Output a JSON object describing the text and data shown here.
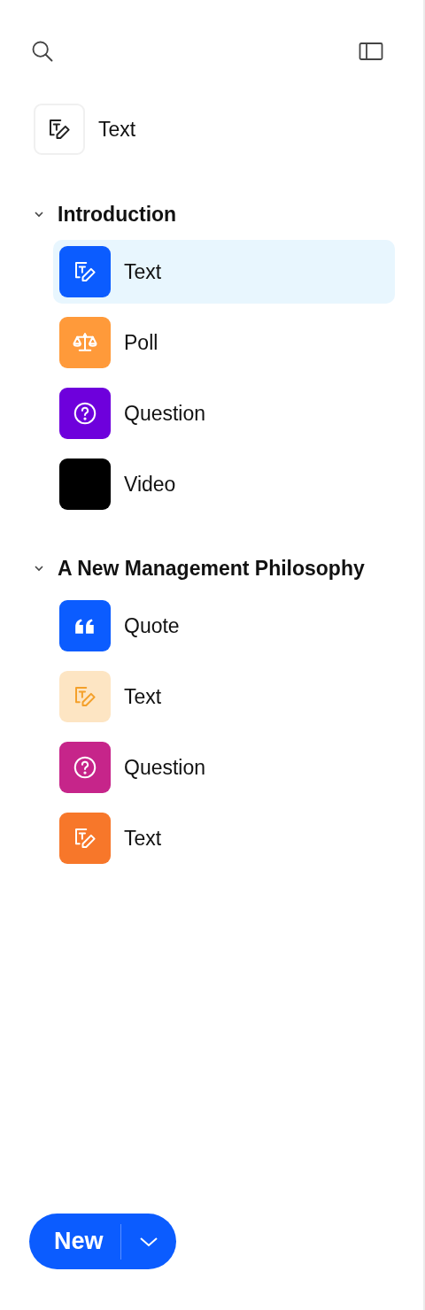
{
  "header": {
    "current": {
      "kind": "text",
      "label": "Text",
      "color": "#ffffff"
    }
  },
  "sections": [
    {
      "title": "Introduction",
      "expanded": true,
      "items": [
        {
          "kind": "text",
          "label": "Text",
          "color": "#0b5cff",
          "selected": true
        },
        {
          "kind": "poll",
          "label": "Poll",
          "color": "#ff9a3a",
          "selected": false
        },
        {
          "kind": "question",
          "label": "Question",
          "color": "#6e00dc",
          "selected": false
        },
        {
          "kind": "video",
          "label": "Video",
          "color": "#000000",
          "selected": false
        }
      ]
    },
    {
      "title": "A New Management Philosophy",
      "expanded": true,
      "items": [
        {
          "kind": "quote",
          "label": "Quote",
          "color": "#0b5cff",
          "selected": false
        },
        {
          "kind": "text",
          "label": "Text",
          "color": "#fde5c3",
          "selected": false
        },
        {
          "kind": "question",
          "label": "Question",
          "color": "#c6258a",
          "selected": false
        },
        {
          "kind": "text",
          "label": "Text",
          "color": "#f7772a",
          "selected": false
        }
      ]
    }
  ],
  "new_button": {
    "label": "New"
  }
}
